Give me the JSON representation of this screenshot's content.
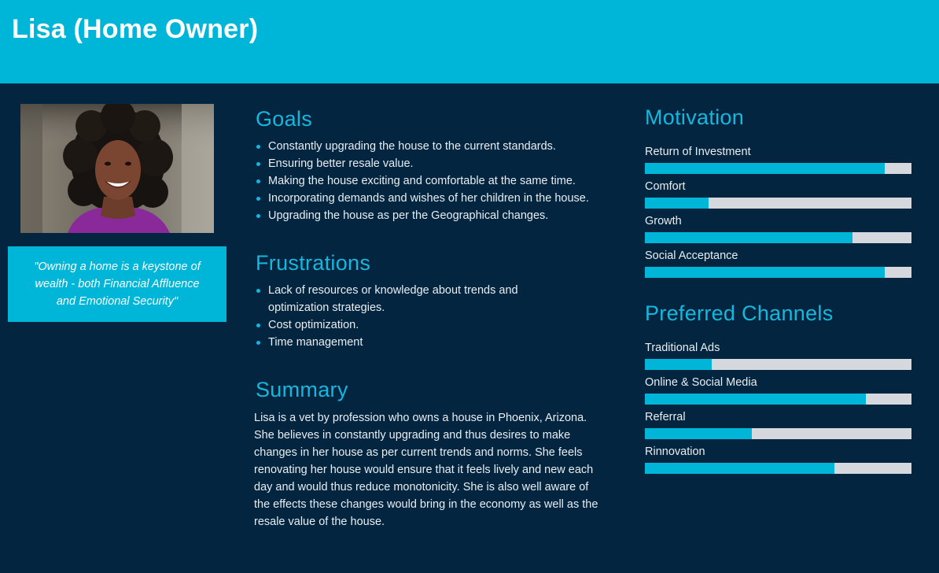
{
  "header": {
    "title": "Lisa (Home Owner)"
  },
  "profile": {
    "quote": "\"Owning a home is a keystone of wealth - both Financial Affluence and Emotional Security\""
  },
  "goals": {
    "title": "Goals",
    "items": [
      "Constantly upgrading the house to the current standards.",
      "Ensuring better resale value.",
      "Making the house exciting and comfortable at the same time.",
      "Incorporating demands and wishes of her children in the house.",
      "Upgrading the house as per the Geographical changes."
    ]
  },
  "frustrations": {
    "title": "Frustrations",
    "items": [
      "Lack of resources or knowledge about trends and optimization strategies.",
      "Cost optimization.",
      "Time management"
    ]
  },
  "summary": {
    "title": "Summary",
    "text": "Lisa is a vet by profession who owns a house in Phoenix, Arizona. She believes in constantly upgrading and thus desires to make changes in her house as per current trends and norms. She feels renovating her house would ensure that it feels lively and new each day and would thus reduce monotonicity. She is also well aware of the effects these changes would bring in the economy  as well as the resale value of the house."
  },
  "motivation": {
    "title": "Motivation",
    "items": [
      {
        "label": "Return of Investment",
        "value": 0.9
      },
      {
        "label": "Comfort",
        "value": 0.24
      },
      {
        "label": "Growth",
        "value": 0.78
      },
      {
        "label": "Social Acceptance",
        "value": 0.9
      }
    ]
  },
  "channels": {
    "title": "Preferred Channels",
    "items": [
      {
        "label": "Traditional Ads",
        "value": 0.25
      },
      {
        "label": "Online & Social Media",
        "value": 0.83
      },
      {
        "label": "Referral",
        "value": 0.4
      },
      {
        "label": "Rinnovation",
        "value": 0.71
      }
    ]
  },
  "colors": {
    "accent": "#00b6d8",
    "background": "#03253f",
    "track": "#d5d8dd"
  }
}
